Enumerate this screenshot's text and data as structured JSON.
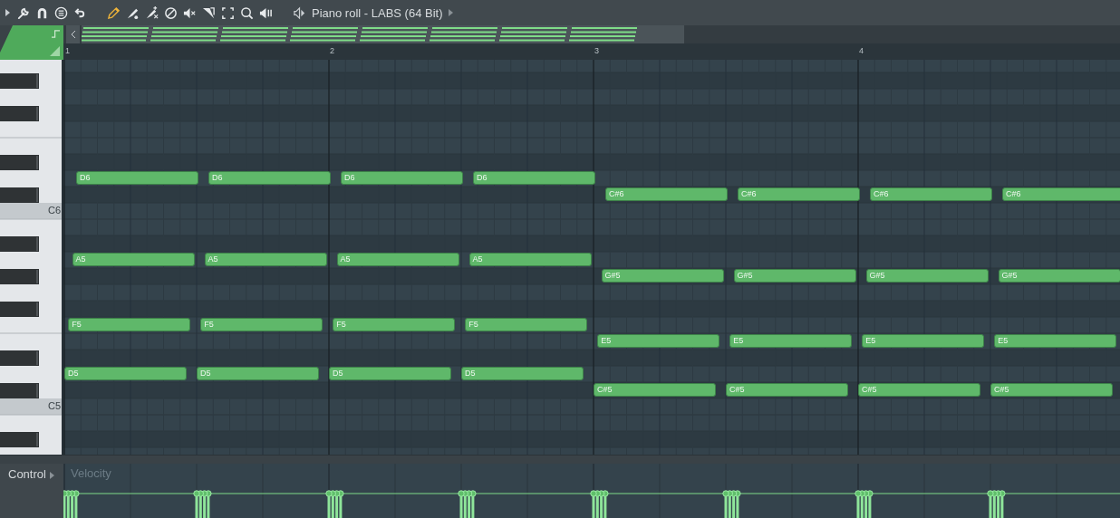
{
  "toolbar": {
    "title": "Piano roll - LABS (64 Bit)",
    "tools": [
      {
        "kind": "pencil",
        "selected": true
      },
      {
        "kind": "brush",
        "selected": false
      },
      {
        "kind": "delete",
        "selected": false
      },
      {
        "kind": "mute",
        "selected": false
      },
      {
        "kind": "slip",
        "selected": false
      },
      {
        "kind": "slice",
        "selected": false
      },
      {
        "kind": "select",
        "selected": false
      },
      {
        "kind": "zoom",
        "selected": false
      },
      {
        "kind": "playback",
        "selected": false
      }
    ]
  },
  "ruler": {
    "bars": [
      "1",
      "2",
      "3",
      "4"
    ]
  },
  "keyboard": {
    "labels": [
      "C6",
      "C5"
    ]
  },
  "chords": [
    {
      "notes": [
        {
          "label": "D6"
        },
        {
          "label": "A5"
        },
        {
          "label": "F5"
        },
        {
          "label": "D5"
        }
      ]
    },
    {
      "notes": [
        {
          "label": "D6"
        },
        {
          "label": "A5"
        },
        {
          "label": "F5"
        },
        {
          "label": "D5"
        }
      ]
    },
    {
      "notes": [
        {
          "label": "D6"
        },
        {
          "label": "A5"
        },
        {
          "label": "F5"
        },
        {
          "label": "D5"
        }
      ]
    },
    {
      "notes": [
        {
          "label": "D6"
        },
        {
          "label": "A5"
        },
        {
          "label": "F5"
        },
        {
          "label": "D5"
        }
      ]
    },
    {
      "notes": [
        {
          "label": "C#6"
        },
        {
          "label": "G#5"
        },
        {
          "label": "E5"
        },
        {
          "label": "C#5"
        }
      ]
    },
    {
      "notes": [
        {
          "label": "C#6"
        },
        {
          "label": "G#5"
        },
        {
          "label": "E5"
        },
        {
          "label": "C#5"
        }
      ]
    },
    {
      "notes": [
        {
          "label": "C#6"
        },
        {
          "label": "G#5"
        },
        {
          "label": "E5"
        },
        {
          "label": "C#5"
        }
      ]
    },
    {
      "notes": [
        {
          "label": "C#6"
        },
        {
          "label": "G#5"
        },
        {
          "label": "E5"
        },
        {
          "label": "C#5"
        }
      ]
    }
  ],
  "control": {
    "label": "Control",
    "lane": "Velocity"
  }
}
